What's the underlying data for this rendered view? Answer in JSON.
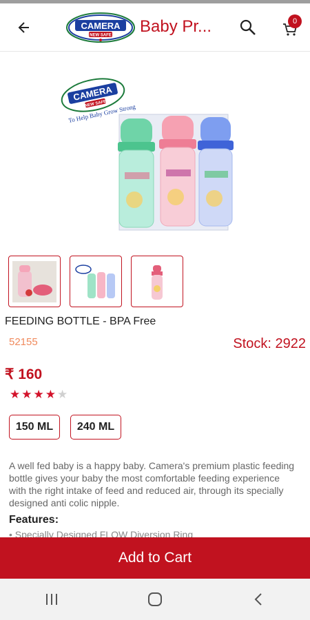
{
  "appbar": {
    "title": "Baby Pr...",
    "logo_text": "CAMERA",
    "logo_subtext": "NEW SAFE",
    "cart_count": "0",
    "accent": "#c1121f",
    "icons": [
      "back-arrow-icon",
      "search-icon",
      "cart-icon"
    ]
  },
  "hero": {
    "logo_text": "CAMERA",
    "logo_subtext": "NEW SAFE",
    "tagline": "To Help Baby Grow Strong",
    "bottle_colors": [
      "#7fd9b0",
      "#f7a3b5",
      "#8aa8f0"
    ]
  },
  "product": {
    "name": "FEEDING BOTTLE - BPA Free",
    "code": "52155",
    "stock": "Stock: 2922",
    "price": "₹ 160",
    "rating": 4,
    "rating_max": 5,
    "variants": [
      "150 ML",
      "240 ML"
    ],
    "description": "A well fed baby is a happy baby. Camera's premium plastic feeding bottle gives your baby the most comfortable feeding experience with the right intake of feed and reduced air, through its specially designed anti colic nipple.",
    "features_title": "Features:",
    "features_first": "• Specially Designed FLOW Diversion Ring"
  },
  "actions": {
    "add_to_cart": "Add to Cart"
  },
  "navbar": {
    "icons": [
      "recent-apps-icon",
      "home-icon",
      "back-icon"
    ]
  }
}
